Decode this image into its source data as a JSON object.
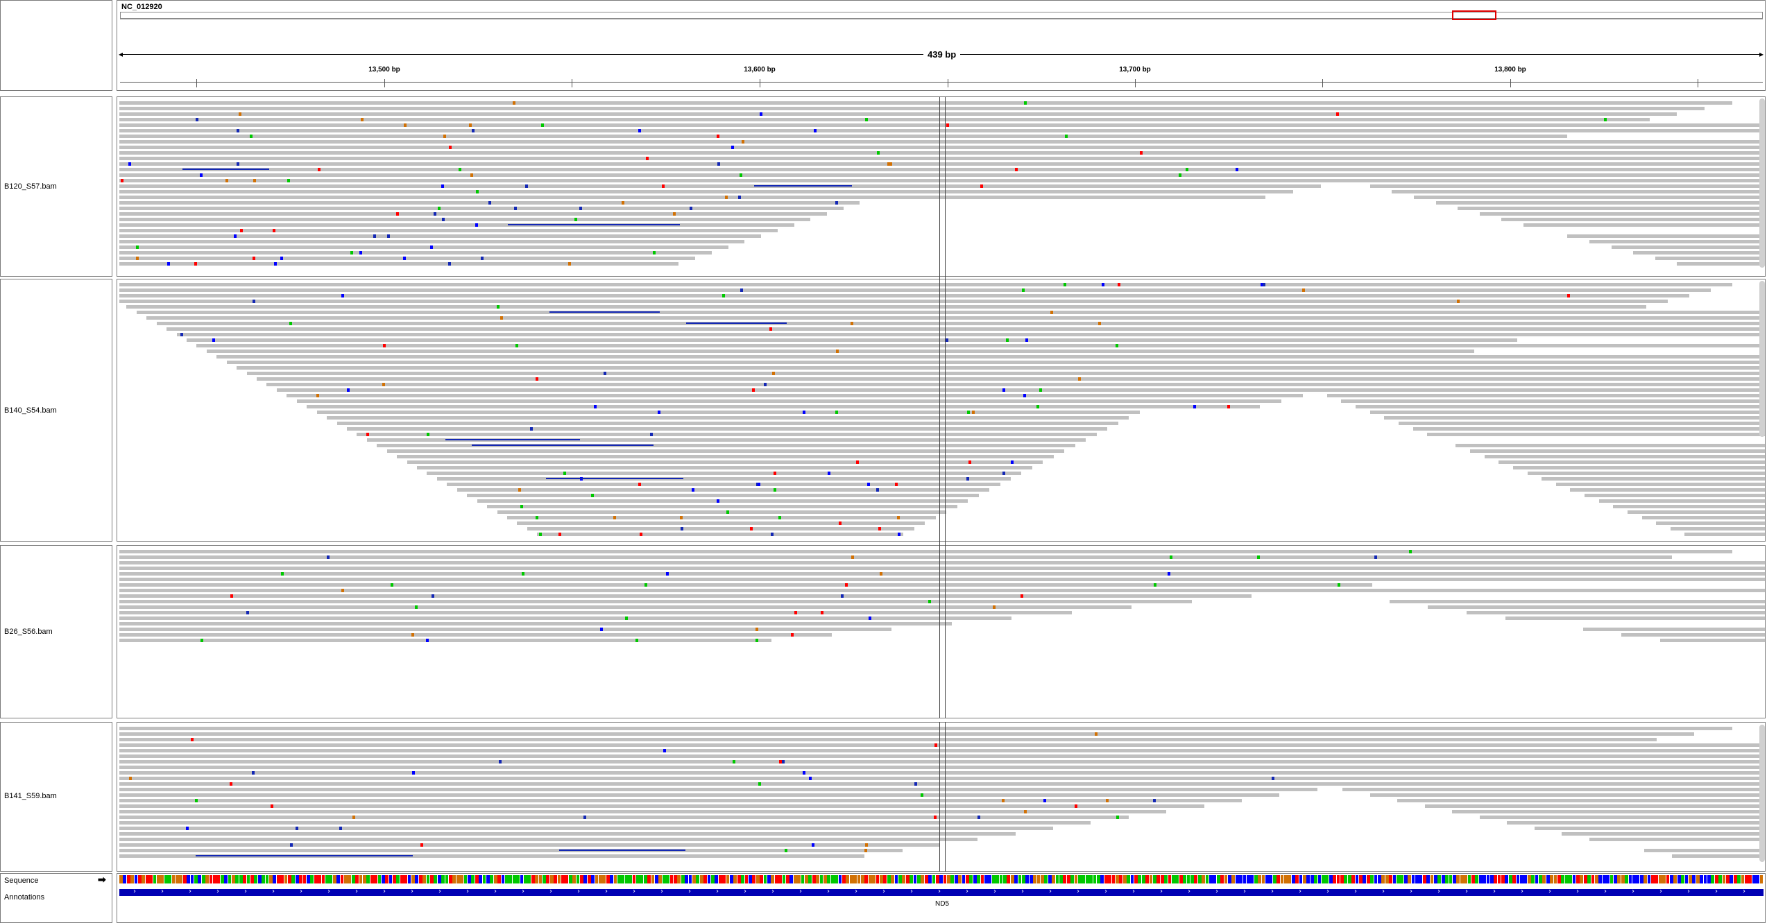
{
  "header": {
    "chromosome": "NC_012920",
    "span_label": "439 bp"
  },
  "ruler": {
    "ticks": [
      "13,500 bp",
      "13,600 bp",
      "13,700 bp",
      "13,800 bp"
    ]
  },
  "tracks": [
    {
      "name": "B120_S57.bam"
    },
    {
      "name": "B140_S54.bam"
    },
    {
      "name": "B26_S56.bam"
    },
    {
      "name": "B141_S59.bam"
    }
  ],
  "bottom": {
    "sequence_label": "Sequence",
    "annotations_label": "Annotations",
    "gene_name": "ND5"
  },
  "colors": {
    "read": "#c0c0c0",
    "insertion_blue": "#1428b4",
    "gene": "#0000b4",
    "region_box": "#e00000",
    "base_A": "#00c800",
    "base_C": "#0000ff",
    "base_G": "#d17105",
    "base_T": "#ff0000"
  }
}
